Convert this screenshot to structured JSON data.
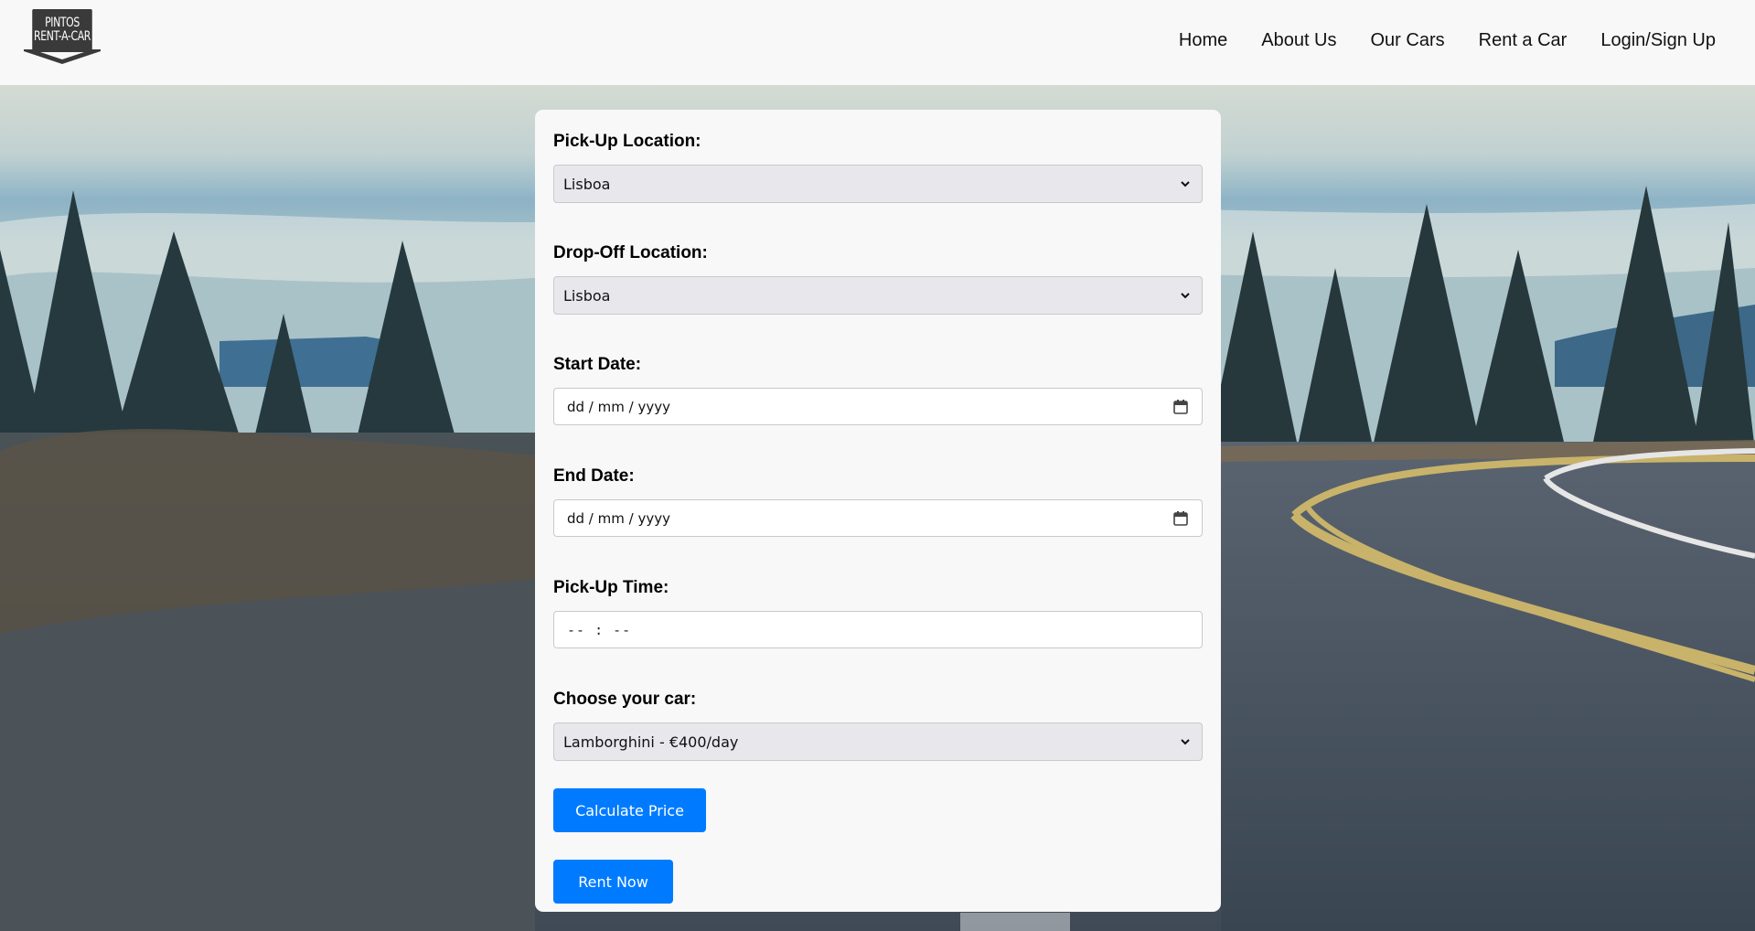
{
  "header": {
    "logo": {
      "line1": "PINTOS",
      "line2": "RENT-A-CAR"
    },
    "nav": [
      {
        "label": "Home"
      },
      {
        "label": "About Us"
      },
      {
        "label": "Our Cars"
      },
      {
        "label": "Rent a Car"
      },
      {
        "label": "Login/Sign Up"
      }
    ]
  },
  "form": {
    "pickup_location": {
      "label": "Pick-Up Location:",
      "value": "Lisboa"
    },
    "dropoff_location": {
      "label": "Drop-Off Location:",
      "value": "Lisboa"
    },
    "start_date": {
      "label": "Start Date:",
      "placeholder": "dd / mm / yyyy",
      "icon": "calendar-icon"
    },
    "end_date": {
      "label": "End Date:",
      "placeholder": "dd / mm / yyyy",
      "icon": "calendar-icon"
    },
    "pickup_time": {
      "label": "Pick-Up Time:",
      "placeholder": "-- : --"
    },
    "car": {
      "label": "Choose your car:",
      "value": "Lamborghini - €400/day"
    },
    "calculate_label": "Calculate Price",
    "rent_label": "Rent Now"
  },
  "colors": {
    "primary": "#007bff",
    "card_bg": "#f8f8f8",
    "select_bg": "#e8e8ec"
  }
}
